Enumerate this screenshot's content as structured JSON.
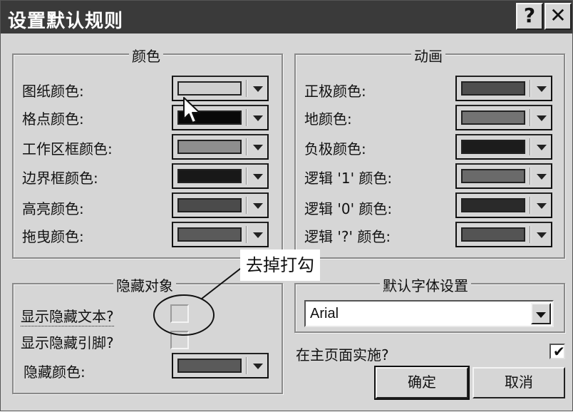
{
  "window": {
    "title": "设置默认规则",
    "help_icon": "?",
    "close_icon": "✕"
  },
  "colors_group": {
    "legend": "颜色",
    "rows": [
      {
        "label": "图纸颜色:",
        "color": "#cfcfcf"
      },
      {
        "label": "格点颜色:",
        "color": "#080808"
      },
      {
        "label": "工作区框颜色:",
        "color": "#8e8e8e"
      },
      {
        "label": "边界框颜色:",
        "color": "#181818"
      },
      {
        "label": "高亮颜色:",
        "color": "#4b4b4b"
      },
      {
        "label": "拖曳颜色:",
        "color": "#5a5a5a"
      }
    ]
  },
  "animation_group": {
    "legend": "动画",
    "rows": [
      {
        "label": "正极颜色:",
        "color": "#4e4e4e"
      },
      {
        "label": "地颜色:",
        "color": "#737373"
      },
      {
        "label": "负极颜色:",
        "color": "#1c1c1c"
      },
      {
        "label": "逻辑 '1' 颜色:",
        "color": "#6a6a6a"
      },
      {
        "label": "逻辑 '0' 颜色:",
        "color": "#2a2a2a"
      },
      {
        "label": "逻辑 '?' 颜色:",
        "color": "#545454"
      }
    ]
  },
  "hidden_group": {
    "legend": "隐藏对象",
    "show_hidden_text": {
      "label": "显示隐藏文本?",
      "checked": false
    },
    "show_hidden_pins": {
      "label": "显示隐藏引脚?",
      "checked": false
    },
    "hidden_color": {
      "label": "隐藏颜色:",
      "color": "#5a5a5a"
    }
  },
  "font_group": {
    "legend": "默认字体设置",
    "font": "Arial"
  },
  "apply_main_page": {
    "label": "在主页面实施?",
    "checked": true,
    "checkmark": "✔"
  },
  "buttons": {
    "ok": "确定",
    "cancel": "取消"
  },
  "annotation": {
    "text": "去掉打勾"
  }
}
